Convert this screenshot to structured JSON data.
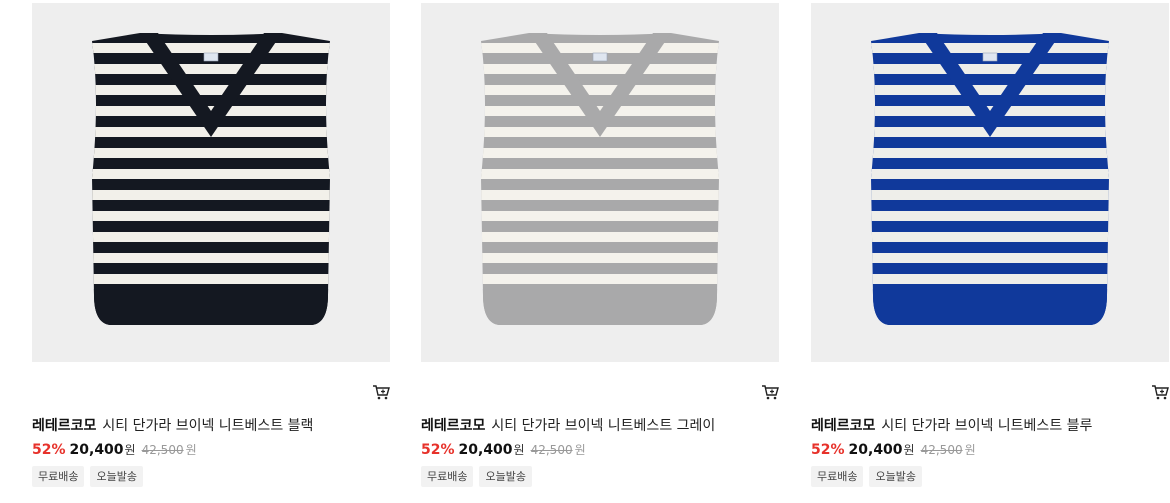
{
  "products": [
    {
      "brand": "레테르코모",
      "name": "시티 단가라 브이넥 니트베스트 블랙",
      "discount": "52%",
      "sale_price": "20,400",
      "currency": "원",
      "original_price": "42,500",
      "tags": [
        "무료배송",
        "오늘발송"
      ],
      "image": {
        "icon": "knit-vest-image",
        "base_color": "#141821",
        "stripe_color": "#f2f0ea"
      }
    },
    {
      "brand": "레테르코모",
      "name": "시티 단가라 브이넥 니트베스트 그레이",
      "discount": "52%",
      "sale_price": "20,400",
      "currency": "원",
      "original_price": "42,500",
      "tags": [
        "무료배송",
        "오늘발송"
      ],
      "image": {
        "icon": "knit-vest-image",
        "base_color": "#a9a9aa",
        "stripe_color": "#f4f2ec"
      }
    },
    {
      "brand": "레테르코모",
      "name": "시티 단가라 브이넥 니트베스트 블루",
      "discount": "52%",
      "sale_price": "20,400",
      "currency": "원",
      "original_price": "42,500",
      "tags": [
        "무료배송",
        "오늘발송"
      ],
      "image": {
        "icon": "knit-vest-image",
        "base_color": "#10399b",
        "stripe_color": "#eeeeea"
      }
    }
  ],
  "cart_icon": "cart-icon",
  "colors": {
    "discount": "#e7322b",
    "thumb_bg": "#eeeeee",
    "tag_bg": "#f2f2f2"
  }
}
